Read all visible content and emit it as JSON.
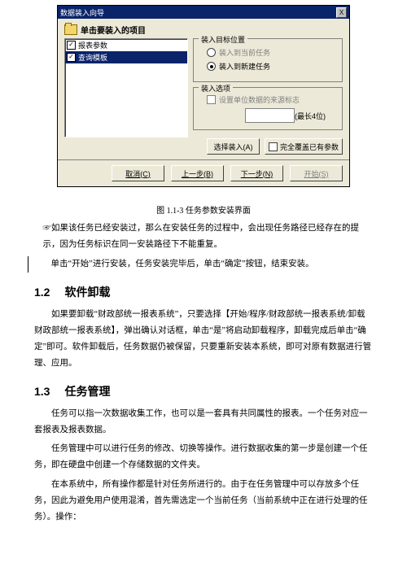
{
  "dialog": {
    "title": "数据装入向导",
    "close": "X",
    "section_label": "单击要装入的项目",
    "list": {
      "items": [
        {
          "checked": true,
          "label": "报表参数",
          "selected": false
        },
        {
          "checked": true,
          "label": "查询模板",
          "selected": true
        }
      ]
    },
    "group_target": {
      "title": "装入目标位置",
      "opt_current": "装入到当前任务",
      "opt_new": "装入到新建任务"
    },
    "group_options": {
      "title": "装入选项",
      "chk_source": "设置单位数据的来源标志",
      "hint": "(最长4位)"
    },
    "row_buttons": {
      "select": "选择装入(A)",
      "overwrite": "完全覆盖已有参数"
    },
    "bottom": {
      "cancel": "取消(C)",
      "back": "上一步(B)",
      "next": "下一步(N)",
      "start": "开始(S)"
    }
  },
  "doc": {
    "fig_cap": "图 1.1-3 任务参数安装界面",
    "p1": "☞如果该任务已经安装过，那么在安装任务的过程中，会出现任务路径已经存在的提示，因为任务标识在同一安装路径下不能重复。",
    "p2": "单击“开始”进行安装，任务安装完毕后，单击“确定”按钮，结束安装。",
    "h12_num": "1.2",
    "h12_txt": "软件卸载",
    "p3": "如果要卸载“财政部统一报表系统”，只要选择【开始/程序/财政部统一报表系统/卸载财政部统一报表系统】，弹出确认对话框，单击“是”将启动卸载程序，卸载完成后单击“确定”即可。软件卸载后，任务数据仍被保留，只要重新安装本系统，即可对原有数据进行管理、应用。",
    "h13_num": "1.3",
    "h13_txt": "任务管理",
    "p4": "任务可以指一次数据收集工作，也可以是一套具有共同属性的报表。一个任务对应一套报表及报表数据。",
    "p5": "任务管理中可以进行任务的修改、切换等操作。进行数据收集的第一步是创建一个任务，即在硬盘中创建一个存储数据的文件夹。",
    "p6": "在本系统中，所有操作都是针对任务所进行的。由于在任务管理中可以存放多个任务，因此为避免用户使用混淆，首先需选定一个当前任务（当前系统中正在进行处理的任务）。操作："
  }
}
